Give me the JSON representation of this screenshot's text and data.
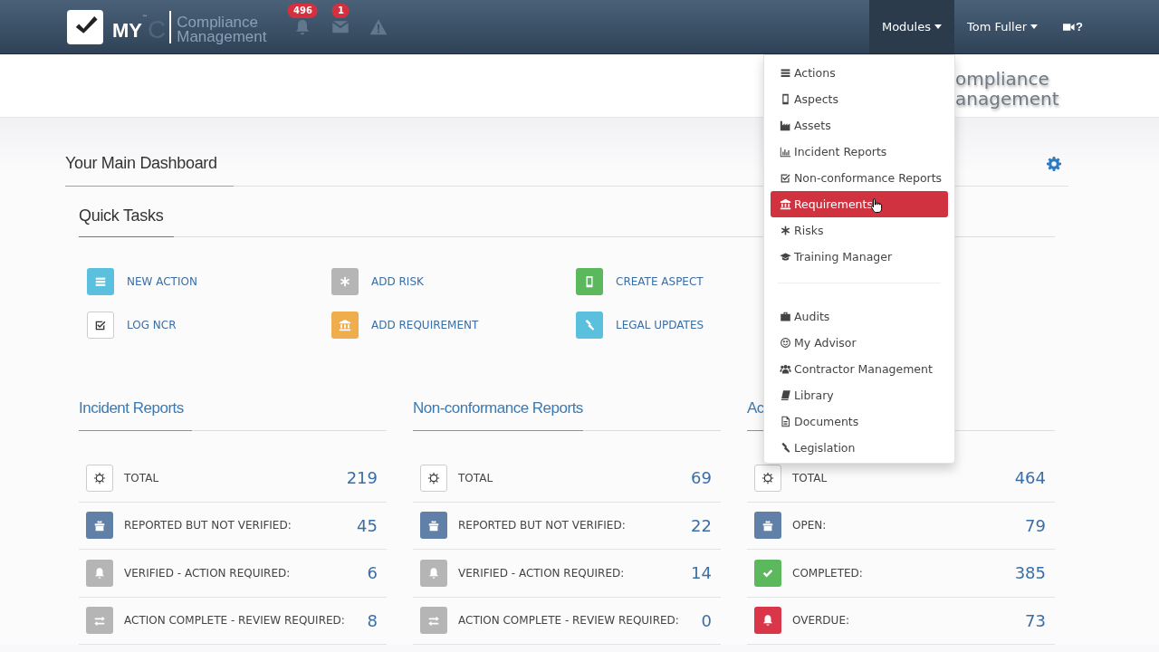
{
  "navbar": {
    "logo": {
      "mark": "MY",
      "tm": "™",
      "letter": "C",
      "line1": "Compliance",
      "line2": "Management"
    },
    "alerts": [
      {
        "kind": "bell",
        "badge": "496"
      },
      {
        "kind": "mail",
        "badge": "1"
      },
      {
        "kind": "warning"
      }
    ],
    "menus": [
      {
        "label": "Modules",
        "selected": true
      },
      {
        "label": "Tom Fuller",
        "selected": false
      }
    ],
    "help": "?"
  },
  "banner": {
    "line1": "ompliance",
    "line2": "anagement"
  },
  "dashboard": {
    "title": "Your Main Dashboard"
  },
  "quick_tasks": {
    "title": "Quick Tasks",
    "tasks": [
      {
        "label": "NEW ACTION",
        "kind": "filled",
        "color": "#5bc0de"
      },
      {
        "label": "ADD RISK",
        "kind": "filled",
        "color": "#b5b5b5"
      },
      {
        "label": "CREATE ASPECT",
        "kind": "filled",
        "color": "#5cb85c"
      },
      {
        "label": "LOG NCR",
        "kind": "outline"
      },
      {
        "label": "ADD REQUIREMENT",
        "kind": "filled",
        "color": "#f0ad4e"
      },
      {
        "label": "LEGAL UPDATES",
        "kind": "filled",
        "color": "#5bc0de"
      }
    ]
  },
  "panels": [
    {
      "title": "Incident Reports",
      "rows": [
        {
          "label": "TOTAL",
          "value": "219",
          "kind": "outline"
        },
        {
          "label": "REPORTED BUT NOT VERIFIED:",
          "value": "45",
          "kind": "filled",
          "color": "#6080a8"
        },
        {
          "label": "VERIFIED - ACTION REQUIRED:",
          "value": "6",
          "kind": "filled",
          "color": "#b5b5b5"
        },
        {
          "label": "ACTION COMPLETE - REVIEW REQUIRED:",
          "value": "8",
          "kind": "filled",
          "color": "#b5b5b5"
        }
      ]
    },
    {
      "title": "Non-conformance Reports",
      "rows": [
        {
          "label": "TOTAL",
          "value": "69",
          "kind": "outline"
        },
        {
          "label": "REPORTED BUT NOT VERIFIED:",
          "value": "22",
          "kind": "filled",
          "color": "#6080a8"
        },
        {
          "label": "VERIFIED - ACTION REQUIRED:",
          "value": "14",
          "kind": "filled",
          "color": "#b5b5b5"
        },
        {
          "label": "ACTION COMPLETE - REVIEW REQUIRED:",
          "value": "0",
          "kind": "filled",
          "color": "#b5b5b5"
        }
      ]
    },
    {
      "title": "Ac",
      "rows": [
        {
          "label": "TOTAL",
          "value": "464",
          "kind": "outline"
        },
        {
          "label": "OPEN:",
          "value": "79",
          "kind": "filled",
          "color": "#6080a8"
        },
        {
          "label": "COMPLETED:",
          "value": "385",
          "kind": "filled",
          "color": "#5cb85c"
        },
        {
          "label": "OVERDUE:",
          "value": "73",
          "kind": "filled",
          "color": "#d9364a"
        }
      ]
    }
  ],
  "modules_menu": {
    "groups": [
      [
        {
          "label": "Actions",
          "selected": false
        },
        {
          "label": "Aspects",
          "selected": false
        },
        {
          "label": "Assets",
          "selected": false
        },
        {
          "label": "Incident Reports",
          "selected": false
        },
        {
          "label": "Non-conformance Reports",
          "selected": false
        },
        {
          "label": "Requirements",
          "selected": true
        },
        {
          "label": "Risks",
          "selected": false
        },
        {
          "label": "Training Manager",
          "selected": false
        }
      ],
      [
        {
          "label": "Audits",
          "selected": false
        },
        {
          "label": "My Advisor",
          "selected": false
        },
        {
          "label": "Contractor Management",
          "selected": false
        },
        {
          "label": "Library",
          "selected": false
        },
        {
          "label": "Documents",
          "selected": false
        },
        {
          "label": "Legislation",
          "selected": false
        }
      ]
    ]
  }
}
